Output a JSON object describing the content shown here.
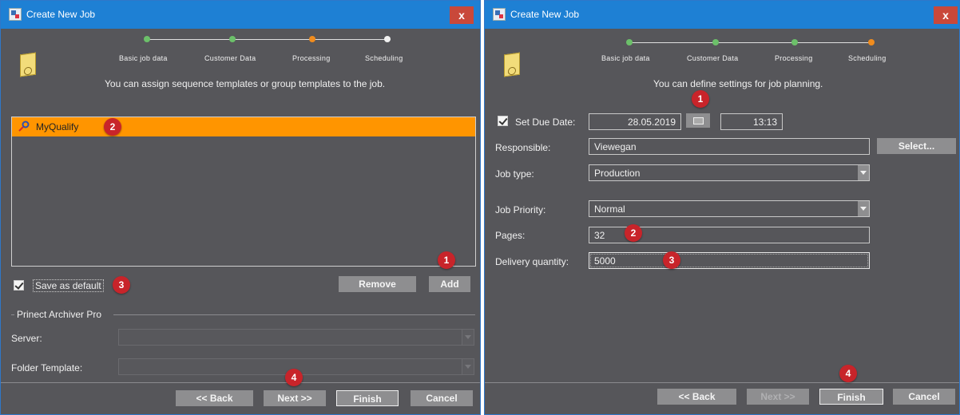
{
  "left": {
    "title": "Create New Job",
    "close": "x",
    "steps": [
      "Basic job data",
      "Customer Data",
      "Processing",
      "Scheduling"
    ],
    "info": "You can assign sequence templates or group templates to the job.",
    "list_item": "MyQualify",
    "remove": "Remove",
    "add": "Add",
    "save_default": "Save as default",
    "archiver_group": "Prinect Archiver Pro",
    "server_label": "Server:",
    "folder_label": "Folder Template:",
    "back": "<< Back",
    "next": "Next >>",
    "finish": "Finish",
    "cancel": "Cancel",
    "badges": [
      "1",
      "2",
      "3",
      "4"
    ]
  },
  "right": {
    "title": "Create New Job",
    "close": "x",
    "steps": [
      "Basic job data",
      "Customer Data",
      "Processing",
      "Scheduling"
    ],
    "info": "You can define settings for job planning.",
    "set_due_date": "Set Due Date:",
    "date": "28.05.2019",
    "time": "13:13",
    "responsible_label": "Responsible:",
    "responsible_value": "Viewegan",
    "select": "Select...",
    "job_type_label": "Job type:",
    "job_type_value": "Production",
    "priority_label": "Job Priority:",
    "priority_value": "Normal",
    "pages_label": "Pages:",
    "pages_value": "32",
    "delivery_label": "Delivery quantity:",
    "delivery_value": "5000",
    "back": "<< Back",
    "next": "Next >>",
    "finish": "Finish",
    "cancel": "Cancel",
    "badges": [
      "1",
      "2",
      "3",
      "4"
    ]
  },
  "colors": {
    "titlebar": "#1e80d4",
    "background": "#56565a",
    "selection": "#ff9500",
    "badge": "#c8242a",
    "step_done": "#6cc06a",
    "step_current": "#f08c1e"
  },
  "icons": [
    "app-icon",
    "close-icon",
    "job-folder-icon",
    "pin-icon",
    "checkbox-checked-icon",
    "calendar-icon",
    "chevron-down-icon"
  ]
}
